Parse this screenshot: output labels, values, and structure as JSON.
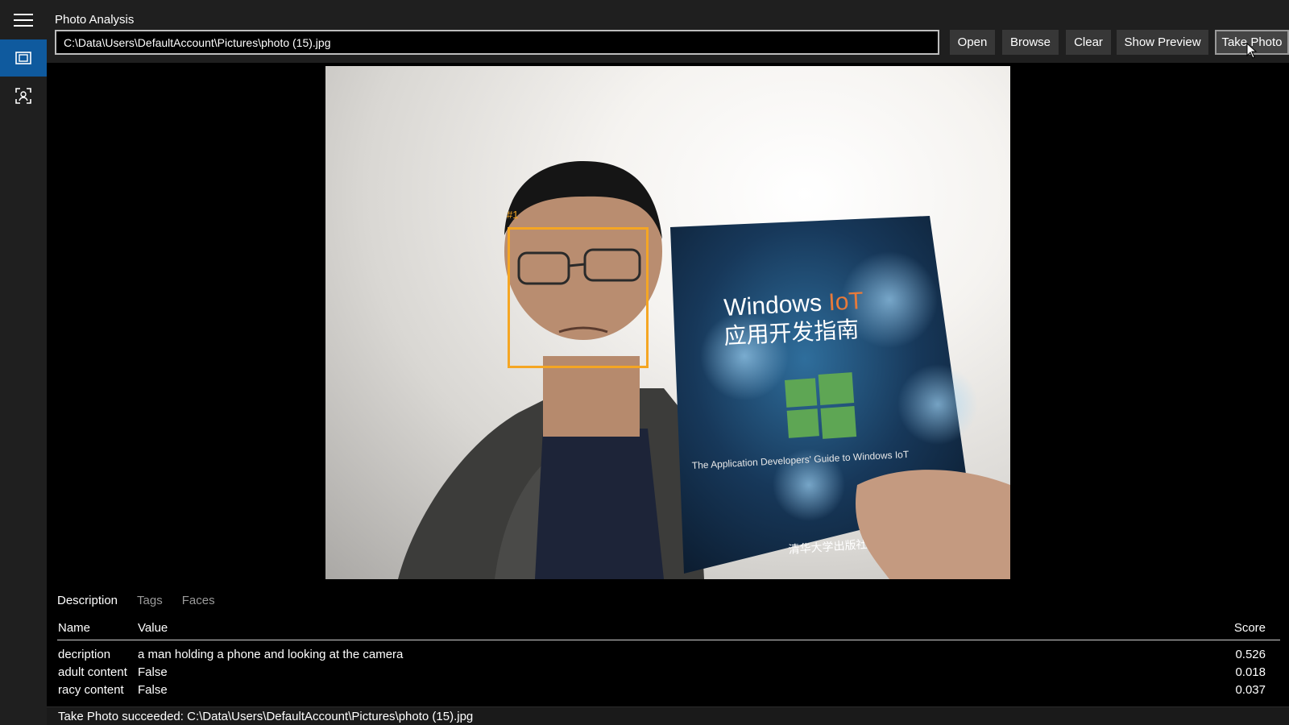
{
  "header": {
    "title": "Photo Analysis",
    "path_value": "C:\\Data\\Users\\DefaultAccount\\Pictures\\photo (15).jpg",
    "buttons": {
      "open": "Open",
      "browse": "Browse",
      "clear": "Clear",
      "show_preview": "Show Preview",
      "take_photo": "Take Photo"
    }
  },
  "nav": {
    "icons": [
      "hamburger-menu-icon",
      "photo-analysis-icon",
      "face-detection-icon"
    ],
    "accent": "#0f5a9e"
  },
  "photo": {
    "face_label": "#1",
    "face_box_color": "#f5a623",
    "book": {
      "title_en": "Windows ",
      "title_highlight": "IoT",
      "title_cn": "应用开发指南",
      "subtitle": "The Application Developers' Guide to Windows IoT",
      "publisher": "清华大学出版社"
    }
  },
  "results": {
    "tabs": [
      "Description",
      "Tags",
      "Faces"
    ],
    "active_tab": "Description",
    "columns": {
      "name": "Name",
      "value": "Value",
      "score": "Score"
    },
    "rows": [
      {
        "name": "decription",
        "value": "a man holding a phone and looking at the camera",
        "score": "0.526"
      },
      {
        "name": "adult content",
        "value": "False",
        "score": "0.018"
      },
      {
        "name": "racy content",
        "value": "False",
        "score": "0.037"
      }
    ]
  },
  "status": "Take Photo succeeded: C:\\Data\\Users\\DefaultAccount\\Pictures\\photo (15).jpg"
}
